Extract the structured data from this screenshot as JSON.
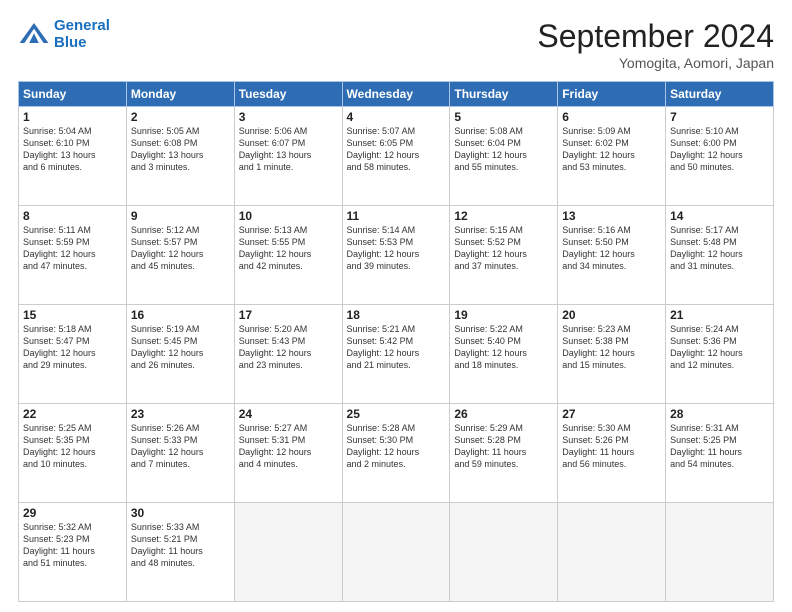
{
  "header": {
    "logo_line1": "General",
    "logo_line2": "Blue",
    "month": "September 2024",
    "location": "Yomogita, Aomori, Japan"
  },
  "weekdays": [
    "Sunday",
    "Monday",
    "Tuesday",
    "Wednesday",
    "Thursday",
    "Friday",
    "Saturday"
  ],
  "weeks": [
    [
      {
        "day": "1",
        "info": "Sunrise: 5:04 AM\nSunset: 6:10 PM\nDaylight: 13 hours\nand 6 minutes."
      },
      {
        "day": "2",
        "info": "Sunrise: 5:05 AM\nSunset: 6:08 PM\nDaylight: 13 hours\nand 3 minutes."
      },
      {
        "day": "3",
        "info": "Sunrise: 5:06 AM\nSunset: 6:07 PM\nDaylight: 13 hours\nand 1 minute."
      },
      {
        "day": "4",
        "info": "Sunrise: 5:07 AM\nSunset: 6:05 PM\nDaylight: 12 hours\nand 58 minutes."
      },
      {
        "day": "5",
        "info": "Sunrise: 5:08 AM\nSunset: 6:04 PM\nDaylight: 12 hours\nand 55 minutes."
      },
      {
        "day": "6",
        "info": "Sunrise: 5:09 AM\nSunset: 6:02 PM\nDaylight: 12 hours\nand 53 minutes."
      },
      {
        "day": "7",
        "info": "Sunrise: 5:10 AM\nSunset: 6:00 PM\nDaylight: 12 hours\nand 50 minutes."
      }
    ],
    [
      {
        "day": "8",
        "info": "Sunrise: 5:11 AM\nSunset: 5:59 PM\nDaylight: 12 hours\nand 47 minutes."
      },
      {
        "day": "9",
        "info": "Sunrise: 5:12 AM\nSunset: 5:57 PM\nDaylight: 12 hours\nand 45 minutes."
      },
      {
        "day": "10",
        "info": "Sunrise: 5:13 AM\nSunset: 5:55 PM\nDaylight: 12 hours\nand 42 minutes."
      },
      {
        "day": "11",
        "info": "Sunrise: 5:14 AM\nSunset: 5:53 PM\nDaylight: 12 hours\nand 39 minutes."
      },
      {
        "day": "12",
        "info": "Sunrise: 5:15 AM\nSunset: 5:52 PM\nDaylight: 12 hours\nand 37 minutes."
      },
      {
        "day": "13",
        "info": "Sunrise: 5:16 AM\nSunset: 5:50 PM\nDaylight: 12 hours\nand 34 minutes."
      },
      {
        "day": "14",
        "info": "Sunrise: 5:17 AM\nSunset: 5:48 PM\nDaylight: 12 hours\nand 31 minutes."
      }
    ],
    [
      {
        "day": "15",
        "info": "Sunrise: 5:18 AM\nSunset: 5:47 PM\nDaylight: 12 hours\nand 29 minutes."
      },
      {
        "day": "16",
        "info": "Sunrise: 5:19 AM\nSunset: 5:45 PM\nDaylight: 12 hours\nand 26 minutes."
      },
      {
        "day": "17",
        "info": "Sunrise: 5:20 AM\nSunset: 5:43 PM\nDaylight: 12 hours\nand 23 minutes."
      },
      {
        "day": "18",
        "info": "Sunrise: 5:21 AM\nSunset: 5:42 PM\nDaylight: 12 hours\nand 21 minutes."
      },
      {
        "day": "19",
        "info": "Sunrise: 5:22 AM\nSunset: 5:40 PM\nDaylight: 12 hours\nand 18 minutes."
      },
      {
        "day": "20",
        "info": "Sunrise: 5:23 AM\nSunset: 5:38 PM\nDaylight: 12 hours\nand 15 minutes."
      },
      {
        "day": "21",
        "info": "Sunrise: 5:24 AM\nSunset: 5:36 PM\nDaylight: 12 hours\nand 12 minutes."
      }
    ],
    [
      {
        "day": "22",
        "info": "Sunrise: 5:25 AM\nSunset: 5:35 PM\nDaylight: 12 hours\nand 10 minutes."
      },
      {
        "day": "23",
        "info": "Sunrise: 5:26 AM\nSunset: 5:33 PM\nDaylight: 12 hours\nand 7 minutes."
      },
      {
        "day": "24",
        "info": "Sunrise: 5:27 AM\nSunset: 5:31 PM\nDaylight: 12 hours\nand 4 minutes."
      },
      {
        "day": "25",
        "info": "Sunrise: 5:28 AM\nSunset: 5:30 PM\nDaylight: 12 hours\nand 2 minutes."
      },
      {
        "day": "26",
        "info": "Sunrise: 5:29 AM\nSunset: 5:28 PM\nDaylight: 11 hours\nand 59 minutes."
      },
      {
        "day": "27",
        "info": "Sunrise: 5:30 AM\nSunset: 5:26 PM\nDaylight: 11 hours\nand 56 minutes."
      },
      {
        "day": "28",
        "info": "Sunrise: 5:31 AM\nSunset: 5:25 PM\nDaylight: 11 hours\nand 54 minutes."
      }
    ],
    [
      {
        "day": "29",
        "info": "Sunrise: 5:32 AM\nSunset: 5:23 PM\nDaylight: 11 hours\nand 51 minutes."
      },
      {
        "day": "30",
        "info": "Sunrise: 5:33 AM\nSunset: 5:21 PM\nDaylight: 11 hours\nand 48 minutes."
      },
      {
        "day": "",
        "info": ""
      },
      {
        "day": "",
        "info": ""
      },
      {
        "day": "",
        "info": ""
      },
      {
        "day": "",
        "info": ""
      },
      {
        "day": "",
        "info": ""
      }
    ]
  ]
}
